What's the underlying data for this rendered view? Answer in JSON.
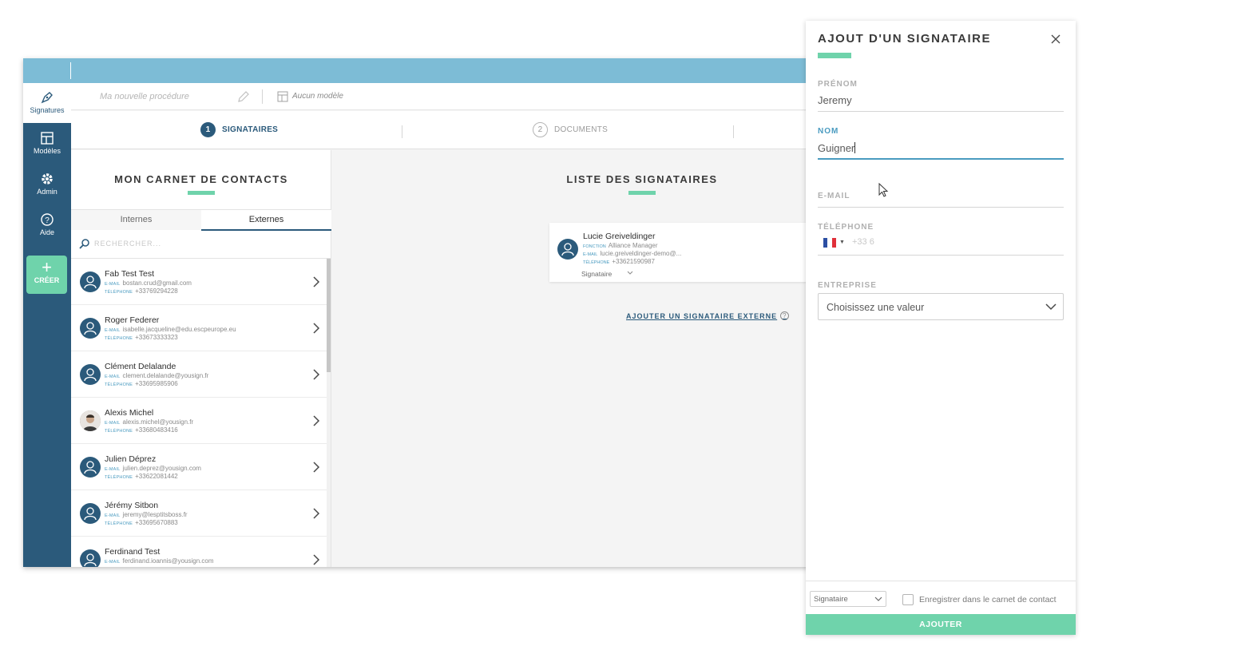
{
  "sidebar": {
    "items": [
      {
        "label": "Signatures",
        "icon": "pen-icon"
      },
      {
        "label": "Modèles",
        "icon": "template-icon"
      },
      {
        "label": "Admin",
        "icon": "gear-icon"
      },
      {
        "label": "Aide",
        "icon": "help-icon"
      }
    ],
    "create_label": "CRÉER"
  },
  "procedure": {
    "name_placeholder": "Ma nouvelle procédure",
    "template_label": "Aucun modèle"
  },
  "steps": [
    {
      "num": "1",
      "label": "SIGNATAIRES"
    },
    {
      "num": "2",
      "label": "DOCUMENTS"
    }
  ],
  "contacts": {
    "title": "MON CARNET DE CONTACTS",
    "tabs": [
      "Internes",
      "Externes"
    ],
    "search_placeholder": "RECHERCHER...",
    "email_label": "E-MAIL",
    "phone_label": "TÉLÉPHONE",
    "items": [
      {
        "name": "Fab Test Test",
        "email": "bostan.crud@gmail.com",
        "phone": "+33769294228"
      },
      {
        "name": "Roger Federer",
        "email": "isabelle.jacqueline@edu.escpeurope.eu",
        "phone": "+33673333323"
      },
      {
        "name": "Clément Delalande",
        "email": "clement.delalande@yousign.fr",
        "phone": "+33695985906"
      },
      {
        "name": "Alexis Michel",
        "email": "alexis.michel@yousign.fr",
        "phone": "+33680483416"
      },
      {
        "name": "Julien Déprez",
        "email": "julien.deprez@yousign.com",
        "phone": "+33622081442"
      },
      {
        "name": "Jérémy Sitbon",
        "email": "jeremy@lesptitsboss.fr",
        "phone": "+33695670883"
      },
      {
        "name": "Ferdinand Test",
        "email": "ferdinand.ioannis@yousign.com",
        "phone": ""
      }
    ]
  },
  "signers": {
    "title": "LISTE DES SIGNATAIRES",
    "card": {
      "name": "Lucie Greiveldinger",
      "function_label": "FONCTION",
      "function": "Alliance Manager",
      "email_label": "E-MAIL",
      "email": "lucie.greiveldinger-demo@...",
      "phone_label": "TÉLÉPHONE",
      "phone": "+33621590987",
      "role": "Signataire"
    },
    "add_external": "AJOUTER UN SIGNATAIRE EXTERNE",
    "help": "?"
  },
  "panel": {
    "title": "AJOUT D'UN SIGNATAIRE",
    "firstname_label": "PRÉNOM",
    "firstname_value": "Jeremy",
    "lastname_label": "NOM",
    "lastname_value": "Guigner",
    "email_label": "E-MAIL",
    "phone_label": "TÉLÉPHONE",
    "phone_placeholder": "+33 6",
    "company_label": "ENTREPRISE",
    "company_value": "Choisissez une valeur",
    "role_value": "Signataire",
    "save_contact_label": "Enregistrer dans le carnet de contact",
    "submit_label": "AJOUTER"
  },
  "colors": {
    "accent": "#6fd3ab",
    "primary": "#2b5a7b",
    "topbar": "#7dbcd6",
    "link": "#4a9bc0"
  }
}
